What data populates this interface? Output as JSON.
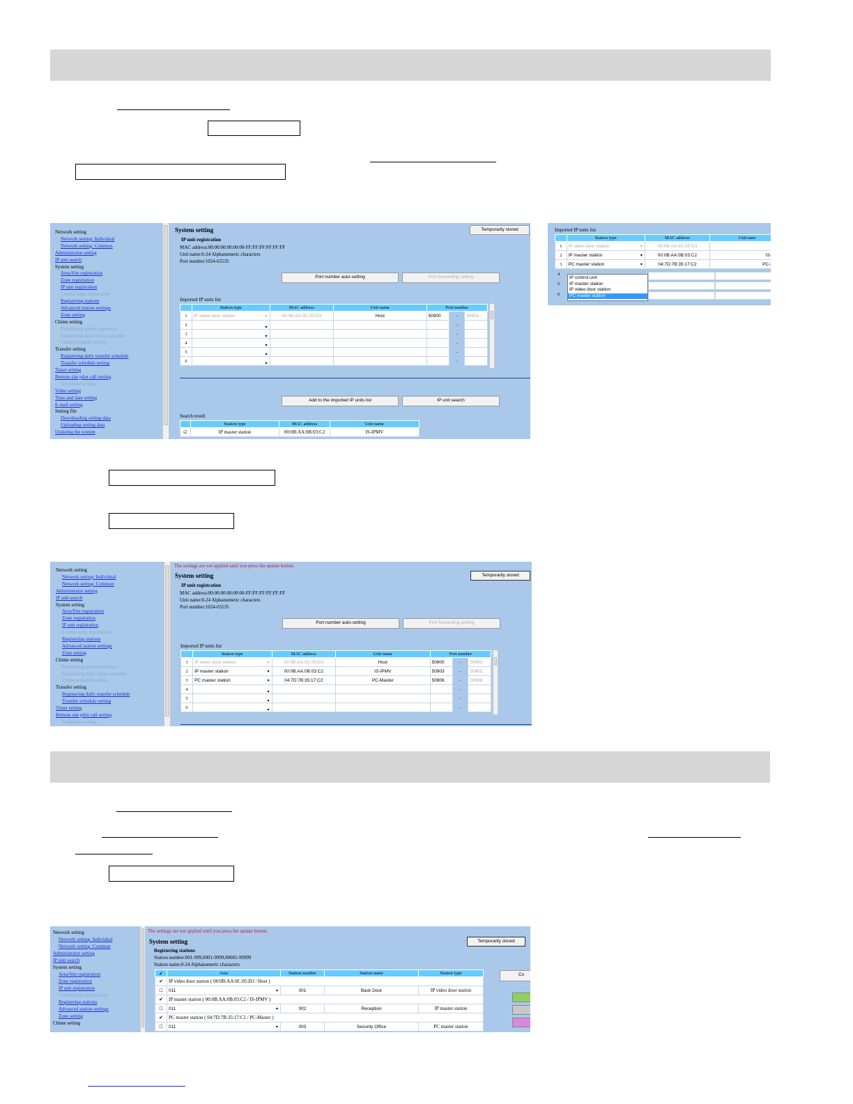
{
  "nav_full": [
    {
      "text": "Network setting",
      "style": "sec"
    },
    {
      "text": "Network setting: Individual",
      "style": "lnk"
    },
    {
      "text": "Network setting: Common",
      "style": "lnk"
    },
    {
      "text": "Administrator setting",
      "style": "lnk"
    },
    {
      "text": "IP unit search",
      "style": "lnk"
    },
    {
      "text": "System setting",
      "style": "sec"
    },
    {
      "text": "Area/Site registration",
      "style": "lnk"
    },
    {
      "text": "Zone registration",
      "style": "lnk"
    },
    {
      "text": "IP unit registration",
      "style": "lnk"
    },
    {
      "text": "Control units registration",
      "style": "dim"
    },
    {
      "text": "Registering stations",
      "style": "lnk"
    },
    {
      "text": "Advanced station settings",
      "style": "lnk"
    },
    {
      "text": "Zone setting",
      "style": "lnk"
    },
    {
      "text": "Chime setting",
      "style": "sec"
    },
    {
      "text": "Registering sound sequences",
      "style": "dim"
    },
    {
      "text": "Registering daily chime schedule",
      "style": "dim"
    },
    {
      "text": "Chime schedule setting",
      "style": "dim"
    },
    {
      "text": "Transfer setting",
      "style": "sec"
    },
    {
      "text": "Registering daily transfer schedule",
      "style": "lnk"
    },
    {
      "text": "Transfer schedule setting",
      "style": "lnk"
    },
    {
      "text": "Timer setting",
      "style": "lnk"
    },
    {
      "text": "Remote site pilot call setting",
      "style": "lnk"
    },
    {
      "text": "Telephone setting",
      "style": "dim"
    },
    {
      "text": "Video setting",
      "style": "lnk"
    },
    {
      "text": "Time and date setting",
      "style": "lnk"
    },
    {
      "text": "E-mail setting",
      "style": "lnk"
    },
    {
      "text": "Setting file",
      "style": "sec"
    },
    {
      "text": "Downloading setting data",
      "style": "lnk"
    },
    {
      "text": "Uploading setting data",
      "style": "lnk"
    },
    {
      "text": "Updating the system",
      "style": "lnk"
    }
  ],
  "common": {
    "system_setting": "System setting",
    "temporarily_stored": "Temporarily stored",
    "ip_unit_registration": "IP unit registration",
    "mac_hint": "MAC address:00:00:00:00:00:00-FF:FF:FF:FF:FF:FF",
    "unit_name_hint": "Unit name:0-24 Alphanumeric characters",
    "port_hint": "Port number:1024-65535",
    "port_auto": "Port number auto-setting",
    "port_forwarding": "Port forwarding setting",
    "imported_list": "Imported IP units list",
    "col_station_type": "Station type",
    "col_mac": "MAC address",
    "col_unit_name": "Unit name",
    "col_port": "Port number",
    "add_imported": "Add to the imported IP units list",
    "ip_unit_search": "IP unit search",
    "search_result": "Search result",
    "not_applied": "The settings are not applied until you press the update button."
  },
  "shot1": {
    "rows": [
      {
        "n": "1",
        "type": "IP video door station",
        "mac": "00:0B:AA:0C:05:D3",
        "name": "Host",
        "port": "50900",
        "port2": "50902"
      },
      {
        "n": "2",
        "type": "",
        "mac": "",
        "name": "",
        "port": "",
        "port2": ""
      },
      {
        "n": "3",
        "type": "",
        "mac": "",
        "name": "",
        "port": "",
        "port2": ""
      },
      {
        "n": "4",
        "type": "",
        "mac": "",
        "name": "",
        "port": "",
        "port2": ""
      },
      {
        "n": "5",
        "type": "",
        "mac": "",
        "name": "",
        "port": "",
        "port2": ""
      },
      {
        "n": "6",
        "type": "",
        "mac": "",
        "name": "",
        "port": "",
        "port2": ""
      }
    ],
    "search_row": {
      "type": "IP master station",
      "mac": "00:0B:AA:0B:03:C2",
      "name": "IS-IPMV"
    }
  },
  "inset": {
    "title": "Imported IP units list",
    "col_unit_name": "Unit nam",
    "rows": [
      {
        "n": "1",
        "type": "IP video door station",
        "mac": "00:0B:AA:0C:05:D3",
        "name": "Host"
      },
      {
        "n": "2",
        "type": "IP master station",
        "mac": "00:0B:AA:0B:03:C2",
        "name": "IS-IPMV"
      },
      {
        "n": "3",
        "type": "PC master station",
        "mac": "04:7D:7B:35:17:C2",
        "name": "PC-Maste"
      }
    ],
    "dropdown": [
      "IP control unit",
      "IP master station",
      "IP video door station",
      "PC master station"
    ]
  },
  "shot2": {
    "rows": [
      {
        "n": "1",
        "type": "IP video door station",
        "mac": "00:0B:AA:0C:05:D3",
        "name": "Host",
        "port": "50900",
        "port2": "50902"
      },
      {
        "n": "2",
        "type": "IP master station",
        "mac": "00:0B:AA:0B:03:C2",
        "name": "IS-IPMV",
        "port": "50903",
        "port2": "50905"
      },
      {
        "n": "3",
        "type": "PC master station",
        "mac": "04:7D:7B:35:17:C2",
        "name": "PC-Master",
        "port": "50906",
        "port2": "50908"
      },
      {
        "n": "4",
        "type": "",
        "mac": "",
        "name": "",
        "port": "",
        "port2": ""
      },
      {
        "n": "5",
        "type": "",
        "mac": "",
        "name": "",
        "port": "",
        "port2": ""
      },
      {
        "n": "6",
        "type": "",
        "mac": "",
        "name": "",
        "port": "",
        "port2": ""
      }
    ]
  },
  "shot3": {
    "registering": "Registering stations",
    "num_hint": "Station number:001-999,0001-9999,00001-99999",
    "name_hint": "Station name:0-24 Alphanumeric characters",
    "col_area": "Area",
    "col_station_number": "Station number",
    "col_station_name": "Station name",
    "col_station_type": "Station type",
    "side_button": "Co",
    "groups": [
      {
        "header": "IP video door station ( 00:0B:AA:0C:05:D3 / Host )",
        "area": "011",
        "number": "001",
        "name": "Back Door",
        "type": "IP video door station"
      },
      {
        "header": "IP master station ( 00:0B:AA:0B:03:C2 / IS-IPMV )",
        "area": "011",
        "number": "002",
        "name": "Reception",
        "type": "IP master station"
      },
      {
        "header": "PC master station ( 04:7D:7B:35:17:C2 / PC-Master )",
        "area": "011",
        "number": "003",
        "name": "Security Office",
        "type": "PC master station"
      }
    ],
    "swatches": [
      "#8fd05f",
      "#c8c8c8",
      "#d88ad8"
    ]
  },
  "glyphs": {
    "caret": "▾",
    "dash": "-",
    "check": "✔"
  }
}
